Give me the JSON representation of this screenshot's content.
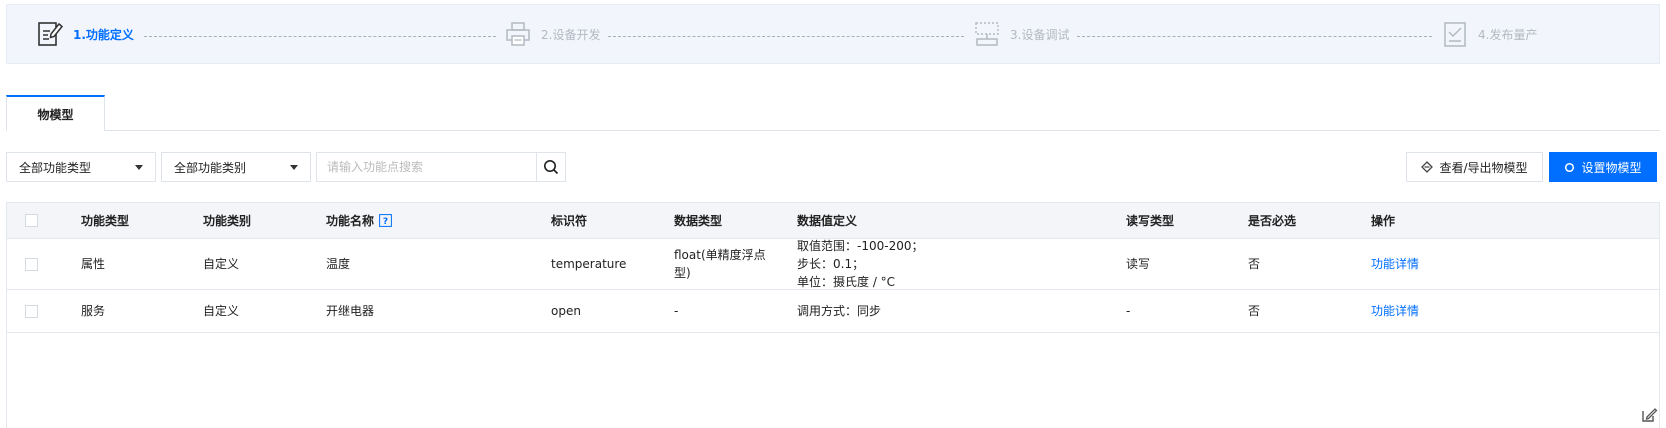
{
  "steps": [
    {
      "label": "1.功能定义",
      "icon": "document-edit-icon",
      "active": true
    },
    {
      "label": "2.设备开发",
      "icon": "printer-icon",
      "active": false
    },
    {
      "label": "3.设备调试",
      "icon": "debug-frame-icon",
      "active": false
    },
    {
      "label": "4.发布量产",
      "icon": "checklist-icon",
      "active": false
    }
  ],
  "tabs": [
    {
      "label": "物模型"
    }
  ],
  "filters": {
    "type_select": "全部功能类型",
    "category_select": "全部功能类别",
    "search_placeholder": "请输入功能点搜索"
  },
  "actions": {
    "export_label": "查看/导出物模型",
    "set_label": "设置物模型"
  },
  "table": {
    "headers": [
      "功能类型",
      "功能类别",
      "功能名称",
      "标识符",
      "数据类型",
      "数据值定义",
      "读写类型",
      "是否必选",
      "操作"
    ],
    "rows": [
      {
        "type": "属性",
        "category": "自定义",
        "name": "温度",
        "identifier": "temperature",
        "data_type": [
          "float(单精度浮点",
          "型)"
        ],
        "definition": [
          "取值范围：-100-200；",
          "步长：0.1；",
          "单位：摄氏度 / °C"
        ],
        "rw": "读写",
        "required": "否",
        "action": "功能详情"
      },
      {
        "type": "服务",
        "category": "自定义",
        "name": "开继电器",
        "identifier": "open",
        "data_type": [
          "-"
        ],
        "definition": [
          "调用方式：同步"
        ],
        "rw": "-",
        "required": "否",
        "action": "功能详情"
      }
    ]
  },
  "colors": {
    "accent": "#006eff",
    "step_bg": "#f2f6fc",
    "inactive": "#b3b8c2"
  }
}
